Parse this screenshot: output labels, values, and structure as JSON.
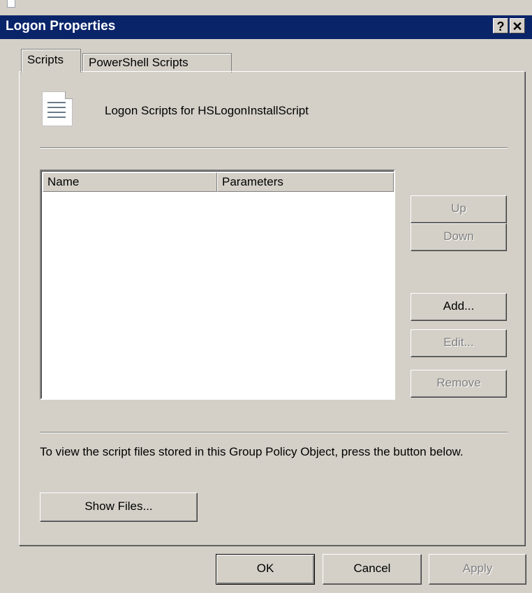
{
  "window": {
    "title": "Logon Properties",
    "help_label": "?",
    "close_label": "✕"
  },
  "tabs": [
    {
      "label": "Scripts",
      "active": true
    },
    {
      "label": "PowerShell Scripts",
      "active": false
    }
  ],
  "header": {
    "icon": "script-file-icon",
    "text": "Logon Scripts for HSLogonInstallScript"
  },
  "list": {
    "columns": [
      "Name",
      "Parameters"
    ],
    "rows": []
  },
  "side_buttons": {
    "up": "Up",
    "down": "Down",
    "add": "Add...",
    "edit": "Edit...",
    "remove": "Remove"
  },
  "description": "To view the script files stored in this Group Policy Object, press the button below.",
  "show_files_label": "Show Files...",
  "footer": {
    "ok": "OK",
    "cancel": "Cancel",
    "apply": "Apply"
  }
}
